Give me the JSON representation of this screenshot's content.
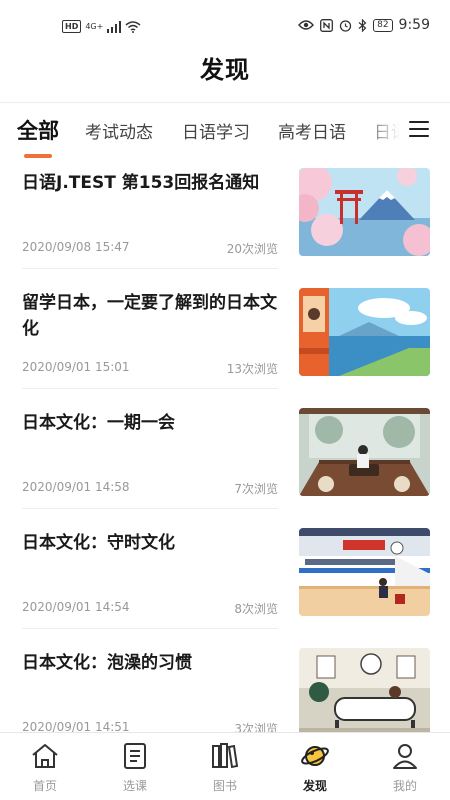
{
  "status_bar": {
    "hd": "HD",
    "network": "4G+",
    "battery": "82",
    "time": "9:59"
  },
  "header": {
    "title": "发现"
  },
  "tabs": [
    {
      "label": "全部",
      "active": true
    },
    {
      "label": "考试动态"
    },
    {
      "label": "日语学习"
    },
    {
      "label": "高考日语"
    },
    {
      "label": "日语"
    }
  ],
  "articles": [
    {
      "title": "日语J.TEST 第153回报名通知",
      "date": "2020/09/08 15:47",
      "views": "20次浏览",
      "thumb": "mount-fuji-torii-illustration"
    },
    {
      "title": "留学日本，一定要了解到的日本文化",
      "date": "2020/09/01 15:01",
      "views": "13次浏览",
      "thumb": "train-window-sea-illustration"
    },
    {
      "title": "日本文化：一期一会",
      "date": "2020/09/01 14:58",
      "views": "7次浏览",
      "thumb": "tea-room-rain-illustration"
    },
    {
      "title": "日本文化：守时文化",
      "date": "2020/09/01 14:54",
      "views": "8次浏览",
      "thumb": "shinkansen-station-illustration"
    },
    {
      "title": "日本文化：泡澡的习惯",
      "date": "2020/09/01 14:51",
      "views": "3次浏览",
      "thumb": "bathtub-room-illustration"
    }
  ],
  "bottom_nav": [
    {
      "label": "首页",
      "icon": "home-icon"
    },
    {
      "label": "选课",
      "icon": "course-icon"
    },
    {
      "label": "图书",
      "icon": "books-icon"
    },
    {
      "label": "发现",
      "icon": "planet-icon",
      "active": true
    },
    {
      "label": "我的",
      "icon": "user-icon"
    }
  ],
  "colors": {
    "accent": "#f0703a",
    "active_text": "#111111",
    "muted": "#999999"
  }
}
